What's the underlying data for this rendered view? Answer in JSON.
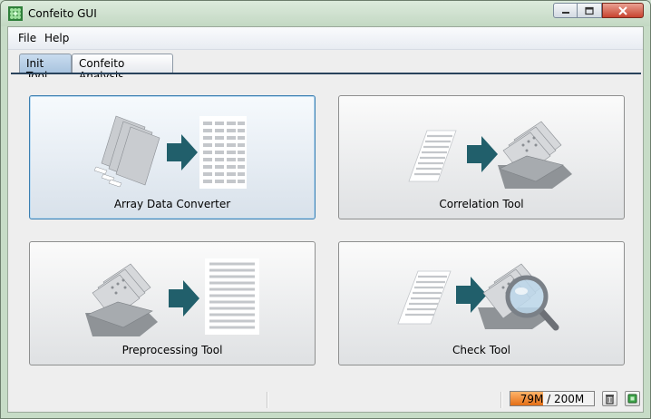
{
  "window": {
    "title": "Confeito GUI",
    "icon": "confeito-app-icon",
    "controls": [
      "minimize-icon",
      "maximize-icon",
      "close-icon"
    ]
  },
  "menu": [
    {
      "label": "File"
    },
    {
      "label": "Help"
    }
  ],
  "tabs": [
    {
      "label": "Init Tool",
      "active": true
    },
    {
      "label": "Confeito Analysis",
      "active": false
    }
  ],
  "tools": [
    {
      "label": "Array Data Converter",
      "icon": "array-data-converter-icon",
      "focused": true
    },
    {
      "label": "Correlation Tool",
      "icon": "correlation-tool-icon",
      "focused": false
    },
    {
      "label": "Preprocessing Tool",
      "icon": "preprocessing-tool-icon",
      "focused": false
    },
    {
      "label": "Check Tool",
      "icon": "check-tool-icon",
      "focused": false
    }
  ],
  "status": {
    "memory_text": "79M / 200M",
    "memory_used": 79,
    "memory_total": 200,
    "buttons": [
      "garbage-collect-icon",
      "indicator-icon"
    ]
  },
  "colors": {
    "arrow": "#215f6b",
    "title_bar": "#c7dcc7",
    "active_tab": "#b8d0e8",
    "memory_fill": "#f08a2a",
    "focus_border": "#3c7fb1"
  }
}
